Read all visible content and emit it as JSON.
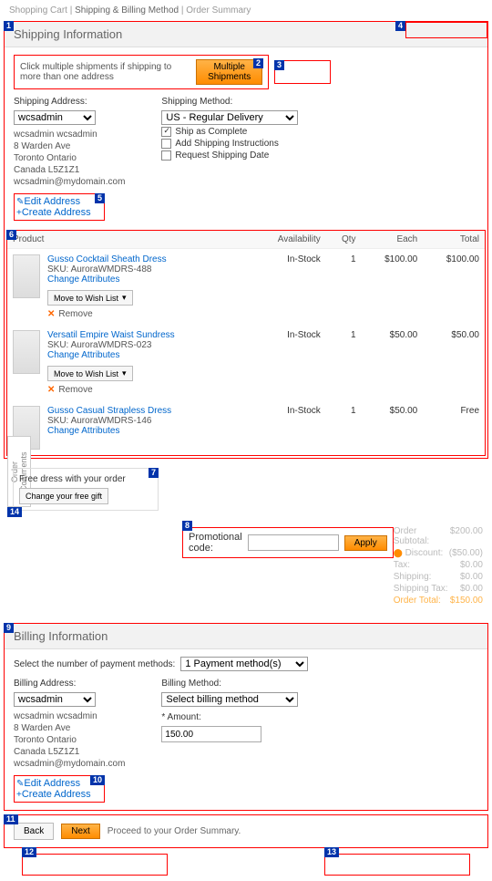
{
  "breadcrumb": {
    "step1": "Shopping Cart",
    "sep": "|",
    "step2": "Shipping & Billing Method",
    "step3": "Order Summary"
  },
  "shipping": {
    "title": "Shipping Information",
    "hint": "Click multiple shipments if shipping to more than one address",
    "multi_btn": "Multiple Shipments",
    "addr_label": "Shipping Address:",
    "addr_select": "wcsadmin",
    "addr_lines": [
      "wcsadmin wcsadmin",
      "8 Warden Ave",
      "Toronto Ontario",
      "Canada L5Z1Z1",
      "wcsadmin@mydomain.com"
    ],
    "method_label": "Shipping Method:",
    "method_select": "US - Regular Delivery",
    "opt_complete": "Ship as Complete",
    "opt_instructions": "Add Shipping Instructions",
    "opt_date": "Request Shipping Date",
    "edit_link": "Edit Address",
    "create_link": "Create Address"
  },
  "cols": {
    "product": "Product",
    "avail": "Availability",
    "qty": "Qty",
    "each": "Each",
    "total": "Total"
  },
  "products": [
    {
      "name": "Gusso Cocktail Sheath Dress",
      "sku": "SKU: AuroraWMDRS-488",
      "change": "Change Attributes",
      "avail": "In-Stock",
      "qty": "1",
      "each": "$100.00",
      "total": "$100.00"
    },
    {
      "name": "Versatil Empire Waist Sundress",
      "sku": "SKU: AuroraWMDRS-023",
      "change": "Change Attributes",
      "avail": "In-Stock",
      "qty": "1",
      "each": "$50.00",
      "total": "$50.00"
    },
    {
      "name": "Gusso Casual Strapless Dress",
      "sku": "SKU: AuroraWMDRS-146",
      "change": "Change Attributes",
      "avail": "In-Stock",
      "qty": "1",
      "each": "$50.00",
      "total": "Free"
    }
  ],
  "wish_label": "Move to Wish List",
  "remove_label": "Remove",
  "order_comments": "Order Comments",
  "freegift": {
    "title": "Free dress with your order",
    "btn": "Change your free gift"
  },
  "promo": {
    "label": "Promotional code:",
    "apply": "Apply"
  },
  "totals": {
    "subtotal_l": "Order Subtotal:",
    "subtotal_v": "$200.00",
    "discount_l": "Discount:",
    "discount_v": "($50.00)",
    "tax_l": "Tax:",
    "tax_v": "$0.00",
    "ship_l": "Shipping:",
    "ship_v": "$0.00",
    "shiptax_l": "Shipping Tax:",
    "shiptax_v": "$0.00",
    "total_l": "Order Total:",
    "total_v": "$150.00"
  },
  "billing": {
    "title": "Billing Information",
    "num_label": "Select the number of payment methods:",
    "num_select": "1 Payment method(s)",
    "addr_label": "Billing Address:",
    "addr_select": "wcsadmin",
    "addr_lines": [
      "wcsadmin wcsadmin",
      "8 Warden Ave",
      "Toronto Ontario",
      "Canada L5Z1Z1",
      "wcsadmin@mydomain.com"
    ],
    "method_label": "Billing Method:",
    "method_select": "Select billing method",
    "amount_label": "* Amount:",
    "amount_value": "150.00",
    "edit_link": "Edit Address",
    "create_link": "Create Address"
  },
  "nav": {
    "back": "Back",
    "next": "Next",
    "proceed": "Proceed to your Order Summary."
  }
}
